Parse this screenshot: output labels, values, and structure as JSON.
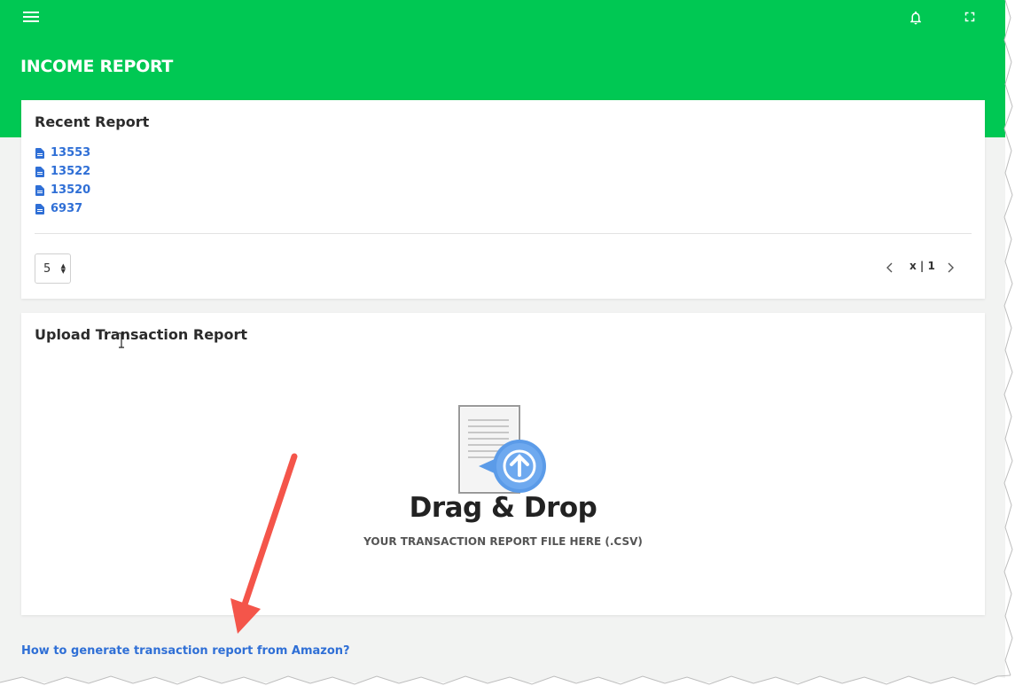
{
  "header": {
    "menu_icon": "hamburger-menu-icon",
    "notification_icon": "bell-icon",
    "fullscreen_icon": "fullscreen-icon",
    "page_title": "INCOME REPORT",
    "background_color": "#00c853"
  },
  "recent_report": {
    "title": "Recent Report",
    "items": [
      {
        "label": "13553",
        "icon": "document-icon"
      },
      {
        "label": "13522",
        "icon": "document-icon"
      },
      {
        "label": "13520",
        "icon": "document-icon"
      },
      {
        "label": "6937",
        "icon": "document-icon"
      }
    ],
    "page_size": "5",
    "pagination": "x | 1"
  },
  "upload": {
    "title": "Upload Transaction Report",
    "drop_title": "Drag & Drop",
    "drop_subtitle": "YOUR TRANSACTION REPORT FILE HERE (.CSV)",
    "drop_icon": "upload-document-icon"
  },
  "help_link": "How to generate transaction report from Amazon?",
  "accent_colors": {
    "link": "#2f6fd6",
    "annotation_arrow": "#f4554a"
  }
}
